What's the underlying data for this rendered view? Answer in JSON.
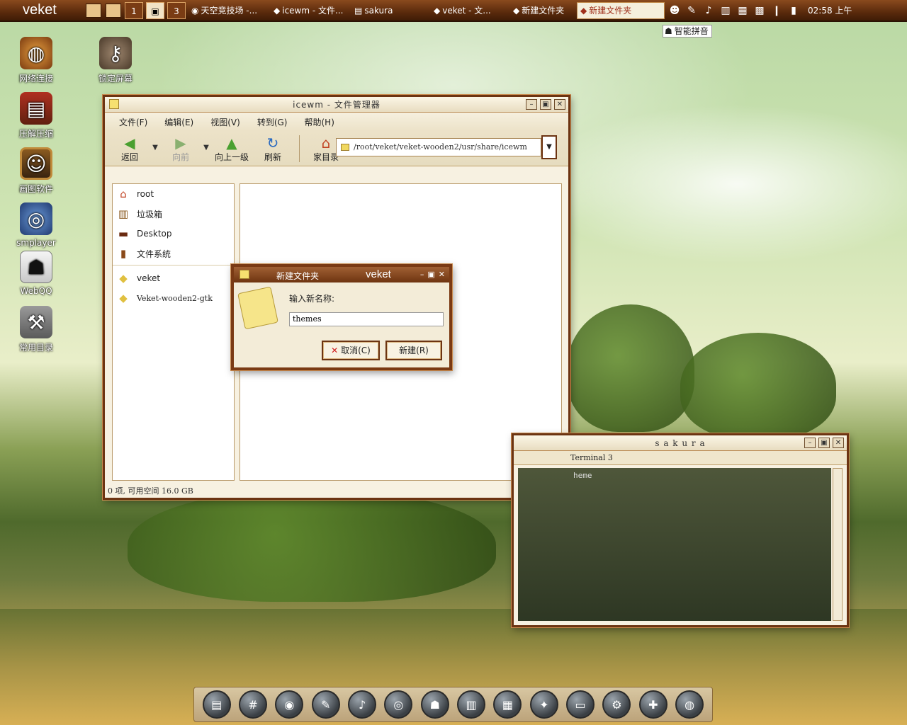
{
  "taskbar": {
    "start_label": "veket",
    "workspaces": [
      "1",
      "",
      "3"
    ],
    "tasks": [
      {
        "label": "天空竞技场 -...",
        "icon": "firefox-icon"
      },
      {
        "label": "icewm - 文件...",
        "icon": "folder-icon"
      },
      {
        "label": "sakura",
        "icon": "terminal-icon"
      },
      {
        "label": "veket - 文...",
        "icon": "folder-icon"
      },
      {
        "label": "新建文件夹",
        "icon": "folder-icon"
      },
      {
        "label": "新建文件夹",
        "icon": "folder-icon"
      }
    ],
    "clock": "02:58 上午"
  },
  "ime": {
    "label": "智能拼音"
  },
  "desktop_icons": [
    {
      "label": "网络连接",
      "icon": "network-globe-icon"
    },
    {
      "label": "锁定屏幕",
      "icon": "lock-icon"
    },
    {
      "label": "压解压缩",
      "icon": "books-icon"
    },
    {
      "label": "画图软件",
      "icon": "painting-icon"
    },
    {
      "label": "smplayer",
      "icon": "film-reel-icon"
    },
    {
      "label": "WebQQ",
      "icon": "penguin-icon"
    },
    {
      "label": "常用目录",
      "icon": "hammer-icon"
    }
  ],
  "file_manager": {
    "title": "icewm  -  文件管理器",
    "menu": [
      "文件(F)",
      "编辑(E)",
      "视图(V)",
      "转到(G)",
      "帮助(H)"
    ],
    "toolbar": {
      "back": "返回",
      "forward": "向前",
      "up": "向上一级",
      "refresh": "刷新",
      "home": "家目录"
    },
    "path": "/root/veket/veket-wooden2/usr/share/icewm",
    "sidebar": [
      "root",
      "垃圾箱",
      "Desktop",
      "文件系统",
      "veket",
      "Veket-wooden2-gtk"
    ],
    "status": "0 项, 可用空间 16.0 GB"
  },
  "dialog": {
    "title": "新建文件夹",
    "title_brand": "veket",
    "label": "输入新名称:",
    "input_value": "themes",
    "cancel": "取消(C)",
    "create": "新建(R)"
  },
  "terminal": {
    "title": "s a k u r a",
    "tab": "Terminal 3",
    "line": "heme"
  },
  "colors": {
    "frame": "#6c3412",
    "accent": "#a0301c"
  }
}
